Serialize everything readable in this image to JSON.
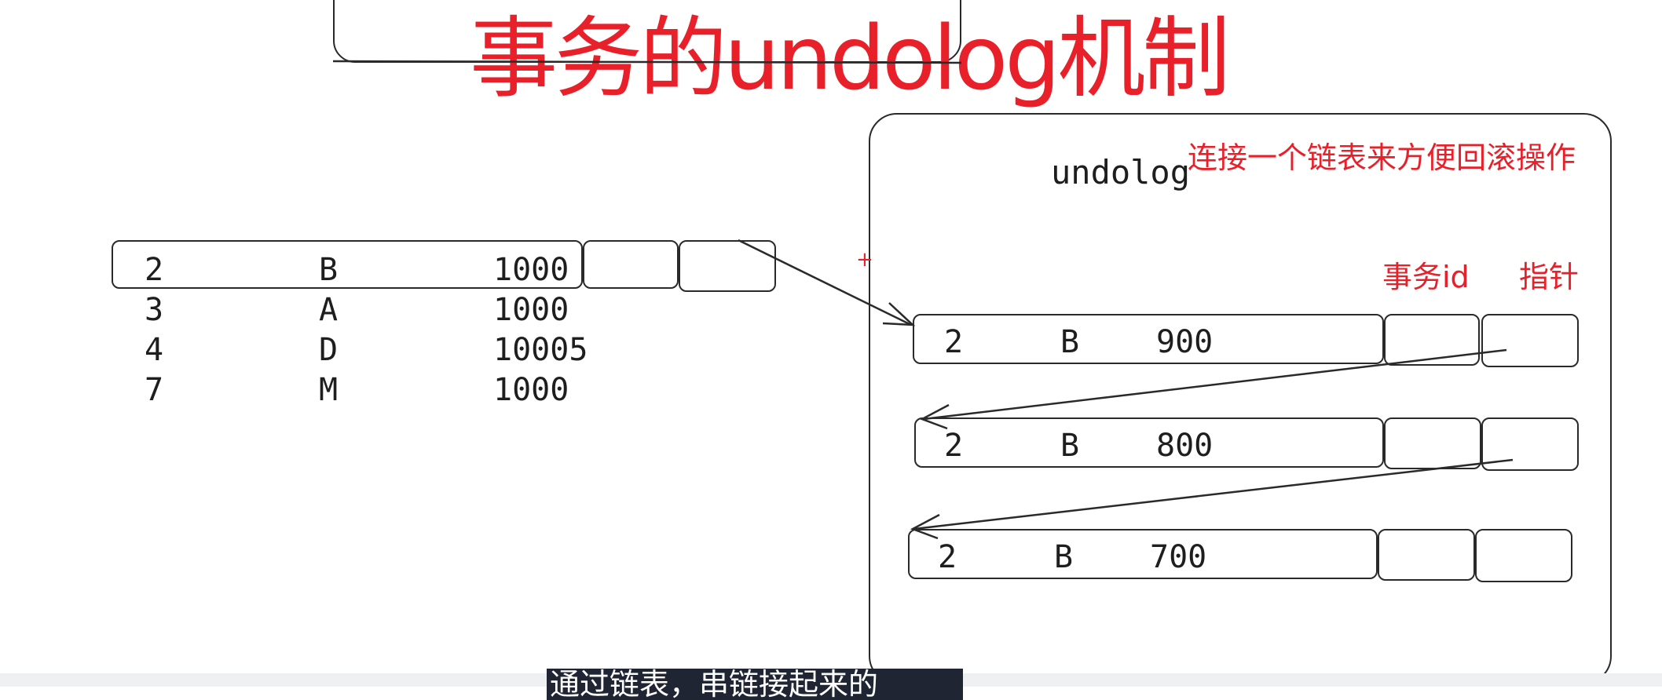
{
  "title": "事务的undolog机制",
  "table": {
    "rows": [
      {
        "id": "2",
        "name": "B",
        "amount": "1000"
      },
      {
        "id": "3",
        "name": "A",
        "amount": "1000"
      },
      {
        "id": "4",
        "name": "D",
        "amount": "10005"
      },
      {
        "id": "7",
        "name": "M",
        "amount": "1000"
      }
    ]
  },
  "undolog": {
    "label": "undolog",
    "note": "连接一个链表来方便回滚操作",
    "col_txid": "事务id",
    "col_pointer": "指针",
    "plus_mark": "+",
    "entries": [
      {
        "id": "2",
        "name": "B",
        "amount": "900"
      },
      {
        "id": "2",
        "name": "B",
        "amount": "800"
      },
      {
        "id": "2",
        "name": "B",
        "amount": "700"
      }
    ]
  },
  "subtitle": "通过链表，串链接起来的"
}
